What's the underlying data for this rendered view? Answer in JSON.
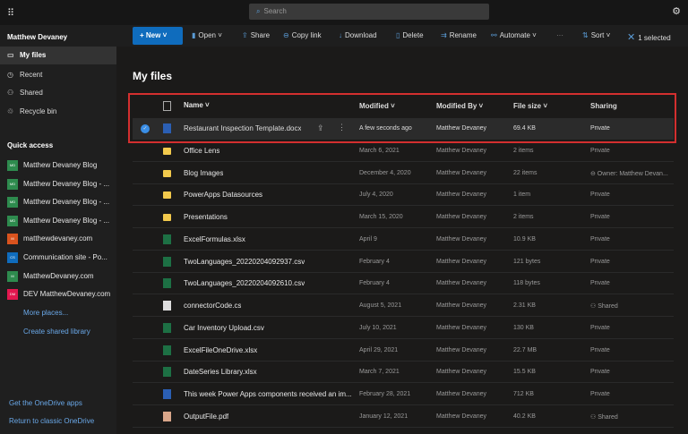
{
  "topbar": {
    "search_placeholder": "Search"
  },
  "user": "Matthew Devaney",
  "commands": {
    "new": "New",
    "open": "Open",
    "share": "Share",
    "copy_link": "Copy link",
    "download": "Download",
    "delete": "Delete",
    "rename": "Rename",
    "automate": "Automate",
    "more": "···",
    "sort": "Sort",
    "selected": "1 selected"
  },
  "sidebar": {
    "items": [
      {
        "label": "My files",
        "icon": "folder-icon"
      },
      {
        "label": "Recent",
        "icon": "clock-icon"
      },
      {
        "label": "Shared",
        "icon": "people-icon"
      },
      {
        "label": "Recycle bin",
        "icon": "trash-icon"
      }
    ],
    "quick_access_title": "Quick access",
    "quick_access": [
      {
        "label": "Matthew Devaney Blog",
        "badge": "MD",
        "color": "#2e8b4e"
      },
      {
        "label": "Matthew Devaney Blog - ...",
        "badge": "MD",
        "color": "#2e8b4e"
      },
      {
        "label": "Matthew Devaney Blog - ...",
        "badge": "MD",
        "color": "#2e8b4e"
      },
      {
        "label": "Matthew Devaney Blog - ...",
        "badge": "MD",
        "color": "#2e8b4e"
      },
      {
        "label": "matthewdevaney.com",
        "badge": "M",
        "color": "#d9531e"
      },
      {
        "label": "Communication site - Po...",
        "badge": "CS",
        "color": "#0f6cbd"
      },
      {
        "label": "MatthewDevaney.com",
        "badge": "M",
        "color": "#2e8b4e"
      },
      {
        "label": "DEV MatthewDevaney.com",
        "badge": "DM",
        "color": "#e3174f"
      }
    ],
    "more_places": "More places...",
    "create_library": "Create shared library",
    "get_apps": "Get the OneDrive apps",
    "classic": "Return to classic OneDrive"
  },
  "page_title": "My files",
  "columns": {
    "name": "Name ˅",
    "modified": "Modified ˅",
    "modified_by": "Modified By ˅",
    "file_size": "File size ˅",
    "sharing": "Sharing"
  },
  "files": [
    {
      "name": "Restaurant Inspection Template.docx",
      "modified": "A few seconds ago",
      "by": "Matthew Devaney",
      "size": "69.4 KB",
      "sharing": "Private",
      "type": "wd",
      "selected": true
    },
    {
      "name": "Office Lens",
      "modified": "March 6, 2021",
      "by": "Matthew Devaney",
      "size": "2 items",
      "sharing": "Private",
      "type": "folder"
    },
    {
      "name": "Blog Images",
      "modified": "December 4, 2020",
      "by": "Matthew Devaney",
      "size": "22 items",
      "sharing": "⊖ Owner: Matthew Devan...",
      "type": "folder"
    },
    {
      "name": "PowerApps Datasources",
      "modified": "July 4, 2020",
      "by": "Matthew Devaney",
      "size": "1 item",
      "sharing": "Private",
      "type": "folder"
    },
    {
      "name": "Presentations",
      "modified": "March 15, 2020",
      "by": "Matthew Devaney",
      "size": "2 items",
      "sharing": "Private",
      "type": "folder"
    },
    {
      "name": "ExcelFormulas.xlsx",
      "modified": "April 9",
      "by": "Matthew Devaney",
      "size": "10.9 KB",
      "sharing": "Private",
      "type": "xl"
    },
    {
      "name": "TwoLanguages_20220204092937.csv",
      "modified": "February 4",
      "by": "Matthew Devaney",
      "size": "121 bytes",
      "sharing": "Private",
      "type": "xl"
    },
    {
      "name": "TwoLanguages_20220204092610.csv",
      "modified": "February 4",
      "by": "Matthew Devaney",
      "size": "118 bytes",
      "sharing": "Private",
      "type": "xl"
    },
    {
      "name": "connectorCode.cs",
      "modified": "August 5, 2021",
      "by": "Matthew Devaney",
      "size": "2.31 KB",
      "sharing": "⚇ Shared",
      "type": "gen"
    },
    {
      "name": "Car Inventory Upload.csv",
      "modified": "July 10, 2021",
      "by": "Matthew Devaney",
      "size": "130 KB",
      "sharing": "Private",
      "type": "xl"
    },
    {
      "name": "ExcelFileOneDrive.xlsx",
      "modified": "April 29, 2021",
      "by": "Matthew Devaney",
      "size": "22.7 MB",
      "sharing": "Private",
      "type": "xl"
    },
    {
      "name": "DateSeries Library.xlsx",
      "modified": "March 7, 2021",
      "by": "Matthew Devaney",
      "size": "15.5 KB",
      "sharing": "Private",
      "type": "xl"
    },
    {
      "name": "This week Power Apps components received an im...",
      "modified": "February 28, 2021",
      "by": "Matthew Devaney",
      "size": "712 KB",
      "sharing": "Private",
      "type": "wd"
    },
    {
      "name": "OutputFile.pdf",
      "modified": "January 12, 2021",
      "by": "Matthew Devaney",
      "size": "40.2 KB",
      "sharing": "⚇ Shared",
      "type": "pdf"
    }
  ]
}
